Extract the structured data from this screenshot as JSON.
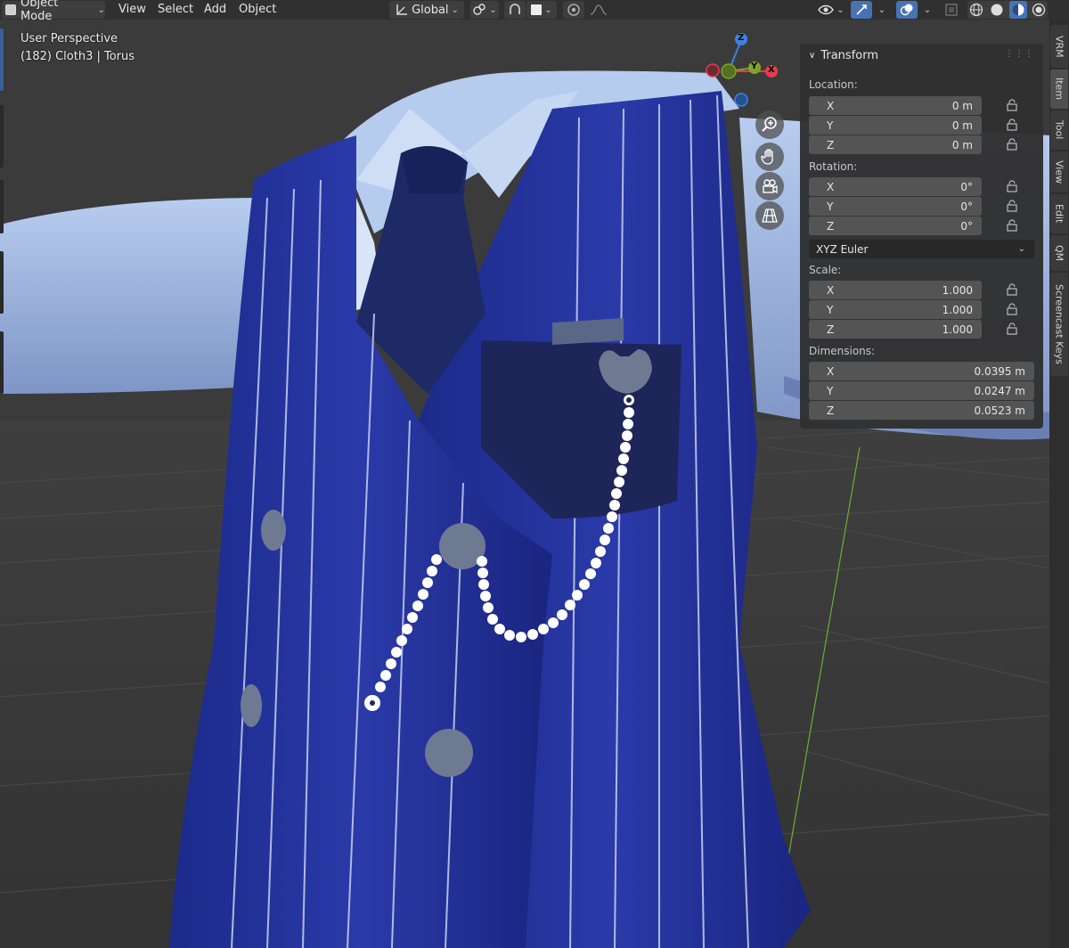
{
  "header": {
    "mode_label": "Object Mode",
    "menus": [
      "View",
      "Select",
      "Add",
      "Object"
    ],
    "orientation_label": "Global",
    "icons": [
      "object-mode-icon",
      "transform-orientation-icon",
      "pivot-icon",
      "snap-icon",
      "snap-target-icon",
      "proportional-edit-icon",
      "falloff-icon",
      "visibility-icon",
      "gizmo-icon",
      "overlay-icon",
      "xray-icon",
      "wireframe-shading-icon",
      "solid-shading-icon",
      "material-shading-icon",
      "rendered-shading-icon"
    ]
  },
  "viewport": {
    "perspective_label": "User Perspective",
    "object_info": "(182) Cloth3 | Torus",
    "gizmo_axes": {
      "z": "Z",
      "y": "Y",
      "x": "X"
    },
    "axis_colors": {
      "x": "#e63c4d",
      "y": "#7ea529",
      "z": "#3c82e6"
    },
    "nav_icons": [
      "zoom-icon",
      "pan-hand-icon",
      "camera-icon",
      "grid-perspective-icon"
    ]
  },
  "npanel": {
    "title": "Transform",
    "location_label": "Location:",
    "location": [
      {
        "axis": "X",
        "value": "0 m"
      },
      {
        "axis": "Y",
        "value": "0 m"
      },
      {
        "axis": "Z",
        "value": "0 m"
      }
    ],
    "rotation_label": "Rotation:",
    "rotation": [
      {
        "axis": "X",
        "value": "0°"
      },
      {
        "axis": "Y",
        "value": "0°"
      },
      {
        "axis": "Z",
        "value": "0°"
      }
    ],
    "rotation_mode": "XYZ Euler",
    "scale_label": "Scale:",
    "scale": [
      {
        "axis": "X",
        "value": "1.000"
      },
      {
        "axis": "Y",
        "value": "1.000"
      },
      {
        "axis": "Z",
        "value": "1.000"
      }
    ],
    "dimensions_label": "Dimensions:",
    "dimensions": [
      {
        "axis": "X",
        "value": "0.0395 m"
      },
      {
        "axis": "Y",
        "value": "0.0247 m"
      },
      {
        "axis": "Z",
        "value": "0.0523 m"
      }
    ]
  },
  "sidebar_tabs": [
    "VRM",
    "Item",
    "Tool",
    "View",
    "Edit",
    "QM",
    "Screencast Keys"
  ],
  "active_tab": "Item"
}
